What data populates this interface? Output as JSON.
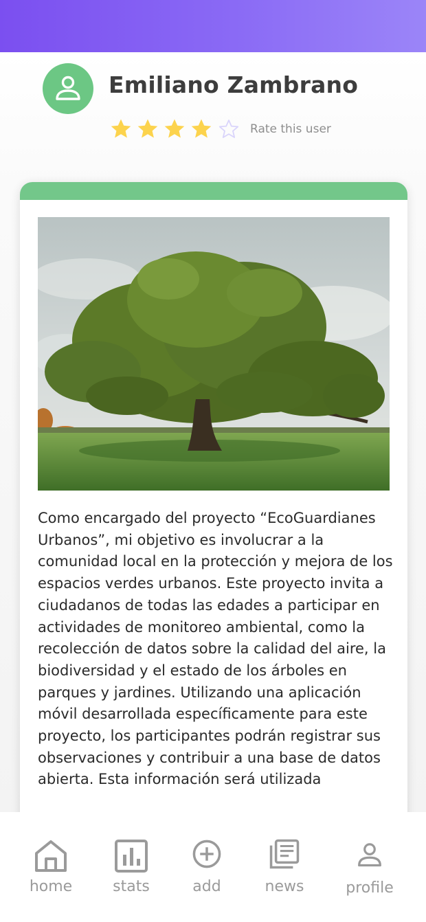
{
  "profile": {
    "name": "Emiliano Zambrano",
    "rating": 4,
    "rating_max": 5,
    "rate_label": "Rate this user",
    "avatar_icon": "person-icon",
    "avatar_color": "#6cc784"
  },
  "colors": {
    "header_gradient_start": "#7b4ff0",
    "header_gradient_end": "#9b85f8",
    "card_accent": "#73c78a",
    "star_filled": "#fcd34d",
    "star_empty": "#d9d4fb"
  },
  "post": {
    "image_icon": "tree-photo",
    "text": "Como encargado del proyecto “EcoGuardianes Urbanos”, mi objetivo es involucrar a la comunidad local en la protección y mejora de los espacios verdes urbanos. Este proyecto invita a ciudadanos de todas las edades a participar en actividades de monitoreo ambiental, como la recolección de datos sobre la calidad del aire, la biodiversidad y el estado de los árboles en parques y jardines. Utilizando una aplicación móvil desarrollada específicamente para este proyecto, los participantes podrán registrar sus observaciones y contribuir a una base de datos abierta. Esta información será utilizada"
  },
  "nav": [
    {
      "label": "home",
      "icon": "home-icon"
    },
    {
      "label": "stats",
      "icon": "stats-icon"
    },
    {
      "label": "add",
      "icon": "add-icon"
    },
    {
      "label": "news",
      "icon": "news-icon"
    },
    {
      "label": "profile",
      "icon": "profile-icon"
    }
  ]
}
